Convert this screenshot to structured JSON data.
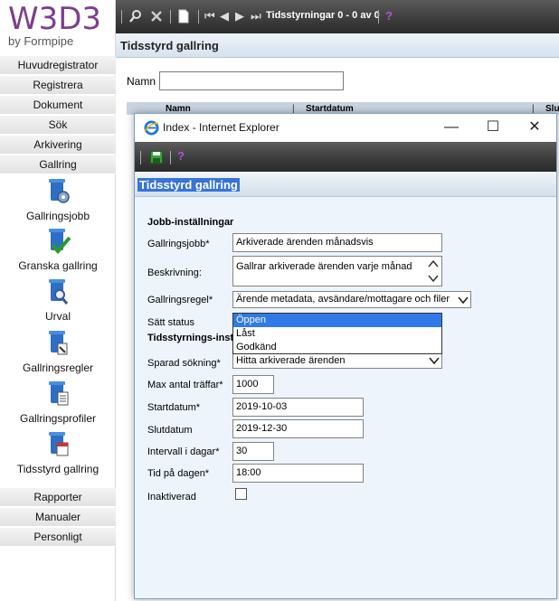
{
  "logo": {
    "brand": "W3D3",
    "by": "by Formpipe"
  },
  "nav": {
    "top": [
      "Huvudregistrator",
      "Registrera",
      "Dokument",
      "Sök",
      "Arkivering",
      "Gallring"
    ],
    "gallring_items": [
      "Gallringsjobb",
      "Granska gallring",
      "Urval",
      "Gallringsregler",
      "Gallringsprofiler",
      "Tidsstyrd gallring"
    ],
    "bottom": [
      "Rapporter",
      "Manualer",
      "Personligt"
    ]
  },
  "toolbar": {
    "record_count": "Tidsstyrningar 0 - 0 av 0"
  },
  "page": {
    "title": "Tidsstyrd gallring",
    "name_label": "Namn",
    "name_value": "",
    "grid_columns": [
      "Namn",
      "Startdatum",
      "Slu"
    ]
  },
  "popup": {
    "window_title": "Index - Internet Explorer",
    "header": "Tidsstyrd gallring",
    "section_job": "Jobb-inställningar",
    "section_schedule": "Tidsstyrnings-inst",
    "fields": {
      "gallringsjobb": {
        "label": "Gallringsjobb*",
        "value": "Arkiverade ärenden månadsvis"
      },
      "beskrivning": {
        "label": "Beskrivning:",
        "value": "Gallrar arkiverade ärenden varje månad"
      },
      "gallringsregel": {
        "label": "Gallringsregel*",
        "value": "Ärende metadata, avsändare/mottagare och filer"
      },
      "satt_status": {
        "label": "Sätt status",
        "options": [
          "Öppen",
          "Låst",
          "Godkänd"
        ],
        "selected": "Öppen"
      },
      "sparad_sokning": {
        "label": "Sparad sökning*",
        "value": "Hitta arkiverade ärenden"
      },
      "max_antal": {
        "label": "Max antal träffar*",
        "value": "1000"
      },
      "startdatum": {
        "label": "Startdatum*",
        "value": "2019-10-03"
      },
      "slutdatum": {
        "label": "Slutdatum",
        "value": "2019-12-30"
      },
      "intervall": {
        "label": "Intervall i dagar*",
        "value": "30"
      },
      "tid": {
        "label": "Tid på dagen*",
        "value": "18:00"
      },
      "inaktiverad": {
        "label": "Inaktiverad",
        "checked": false
      }
    }
  },
  "colors": {
    "brand": "#7d3e8e",
    "selection": "#2f7ae8",
    "toolbar": "#3c3c3c",
    "help": "#9b3fc0"
  }
}
